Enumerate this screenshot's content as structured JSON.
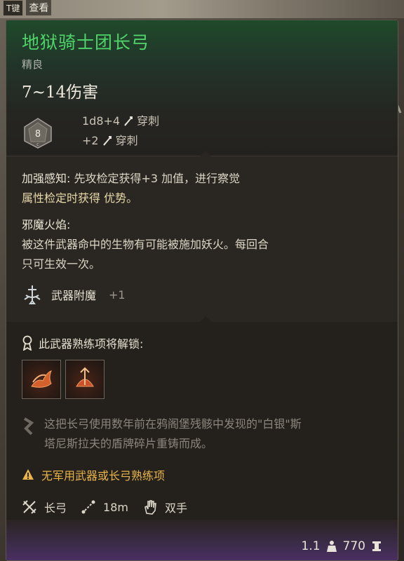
{
  "hotkey": {
    "key": "T键",
    "label": "查看"
  },
  "item": {
    "name": "地狱骑士团长弓",
    "rarity": "精良",
    "damage": "7~14伤害",
    "die": "8",
    "damage_lines": [
      {
        "value": "1d8+4",
        "type": "穿刺"
      },
      {
        "value": "+2",
        "type": "穿刺"
      }
    ]
  },
  "passives": [
    {
      "name": "加强感知:",
      "text_a": "先攻检定获得+3 加值，进行察觉",
      "text_b": "属性检定时获得 优势。"
    },
    {
      "name": "邪魔火焰:",
      "line1": "被这件武器命中的生物有可能被施加妖火。每回合",
      "line2": "只可生效一次。"
    }
  ],
  "enchantment": {
    "label": "武器附魔",
    "value": "+1"
  },
  "unlock": {
    "title": "此武器熟练项将解锁:",
    "actions": [
      "flame-arrow-action-icon",
      "ritual-arrow-action-icon"
    ]
  },
  "lore": {
    "line1": "这把长弓使用数年前在鸦阁堡残骸中发现的\"白银\"斯",
    "line2": "塔尼斯拉夫的盾牌碎片重铸而成。"
  },
  "warning": "无军用武器或长弓熟练项",
  "properties": [
    {
      "icon": "crossed-swords-icon",
      "label": "长弓"
    },
    {
      "icon": "range-icon",
      "label": "18m"
    },
    {
      "icon": "hand-icon",
      "label": "双手"
    }
  ],
  "footer": {
    "weight": "1.1",
    "price": "770"
  },
  "colors": {
    "name": "#4fd46a",
    "warning": "#e8b44a",
    "highlight": "#e8d9a8"
  }
}
